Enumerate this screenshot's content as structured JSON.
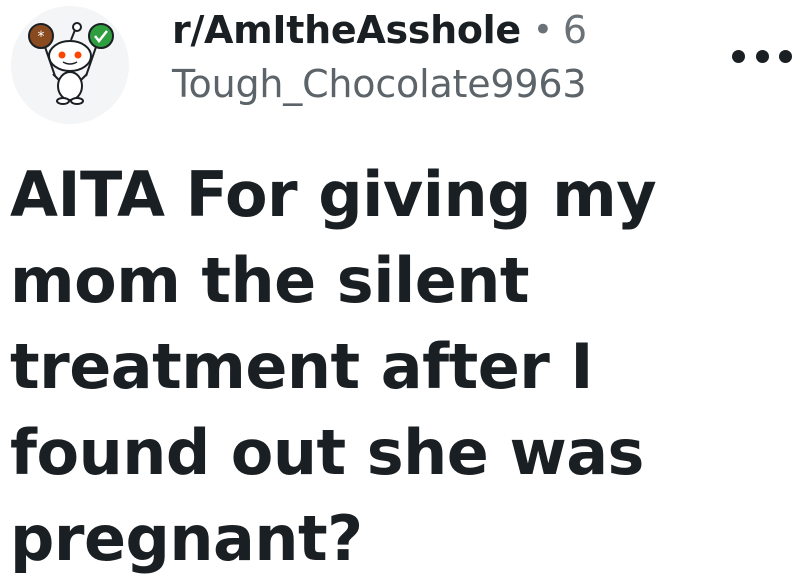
{
  "post": {
    "subreddit": "r/AmItheAsshole",
    "separator": "•",
    "age": "6",
    "author": "Tough_Chocolate9963",
    "title": "AITA For giving my mom the silent treatment after I found out she was pregnant?"
  },
  "icons": {
    "avatar": "reddit-snoo-holding-signs-icon",
    "more": "more-options-icon"
  },
  "colors": {
    "text": "#1a1f23",
    "muted": "#6a7278",
    "snoo_sign_left": "#8a4a1f",
    "snoo_sign_right": "#2e9e3f",
    "snoo_eyes": "#ff4500"
  }
}
